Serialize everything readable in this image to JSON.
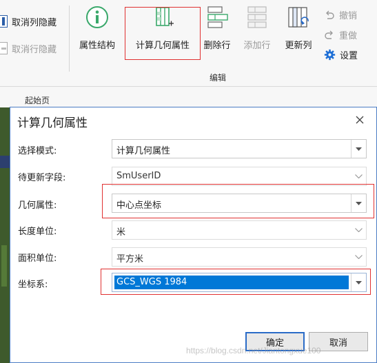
{
  "ribbon": {
    "small_left": [
      {
        "label": "取消列隐藏",
        "icon": "column-hide-icon",
        "enabled": true
      },
      {
        "label": "取消行隐藏",
        "icon": "row-hide-icon",
        "enabled": false
      }
    ],
    "buttons": {
      "attr_structure": "属性结构",
      "calc_geom": "计算几何属性",
      "delete_row": "删除行",
      "add_row": "添加行",
      "update_column": "更新列"
    },
    "side": {
      "undo": "撤销",
      "redo": "重做",
      "settings": "设置"
    },
    "group_label": "编辑",
    "tab_label": "起始页"
  },
  "dialog": {
    "title": "计算几何属性",
    "rows": [
      {
        "label": "选择模式:",
        "value": "计算几何属性",
        "enabled": true
      },
      {
        "label": "待更新字段:",
        "value": "SmUserID",
        "enabled": false
      },
      {
        "label": "几何属性:",
        "value": "中心点坐标",
        "enabled": true
      },
      {
        "label": "长度单位:",
        "value": "米",
        "enabled": false
      },
      {
        "label": "面积单位:",
        "value": "平方米",
        "enabled": false
      },
      {
        "label": "坐标系:",
        "value": "GCS_WGS 1984",
        "enabled": true,
        "selected": true
      }
    ],
    "ok": "确定",
    "cancel": "取消"
  },
  "watermark": "https://blog.csdn.net/Jiantongxue100",
  "colors": {
    "accent": "#0078d7",
    "highlight": "#e03030",
    "settings_icon": "#1e6fd6"
  }
}
